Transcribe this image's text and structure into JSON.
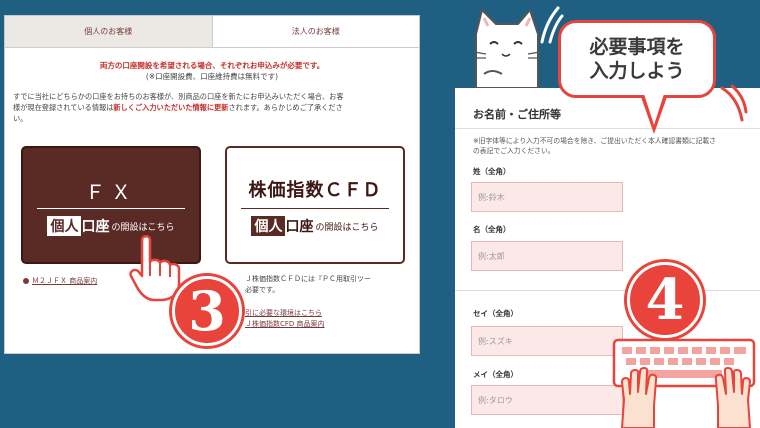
{
  "left_panel": {
    "tabs": [
      {
        "label": "個人のお客様",
        "active": false
      },
      {
        "label": "法人のお客様",
        "active": true
      }
    ],
    "notice_red": "両方の口座開設を希望される場合、それぞれお申込みが必要です。",
    "notice_sub": "(※口座開設費、口座維持費は無料です)",
    "desc_a": "すでに当社にどちらかの口座をお持ちのお客様が、別商品の口座を新たにお申込みいただく場合、お客",
    "desc_b1": "様が現在登録されている情報は",
    "desc_b_red": "新しくご入力いただいた情報に更新",
    "desc_b2": "されます。あらかじめご了承くださ",
    "desc_c": "い。",
    "card_fx": {
      "title": "ＦＸ",
      "box1": "個人",
      "box2": "口座",
      "tail": "の開設はこちら"
    },
    "card_cfd": {
      "title": "株価指数ＣＦＤ",
      "box1": "個人",
      "box2": "口座",
      "tail": "の開設はこちら"
    },
    "fx_link": "Ｍ２ＪＦＸ 商品案内",
    "cfd_note_1": "Ｊ株価指数ＣＦＤには『ＰＣ用取引ツー",
    "cfd_note_2": "必要です。",
    "cfd_link_1": "引に必要な環境はこちら",
    "cfd_link_2": "Ｊ株価指数CFD 商品案内",
    "step_number": "3"
  },
  "bubble": {
    "line1": "必要事項を",
    "line2": "入力しよう"
  },
  "right_panel": {
    "title": "お名前・ご住所等",
    "note_1": "※旧字体等により入力不可の場合を除き、ご提出いただく本人確認書類に記載さ",
    "note_2": "の表記でご入力ください。",
    "fields": [
      {
        "label": "姓（全角）",
        "placeholder": "例:鈴木"
      },
      {
        "label": "名（全角）",
        "placeholder": "例:太郎"
      },
      {
        "label": "セイ（全角）",
        "placeholder": "例:スズキ"
      },
      {
        "label": "メイ（全角）",
        "placeholder": "例:タロウ"
      }
    ],
    "step_number": "4"
  },
  "colors": {
    "background": "#1f5f82",
    "brown": "#5a2a24",
    "accent_red": "#e8443b",
    "input_pink": "#fde8e8"
  }
}
